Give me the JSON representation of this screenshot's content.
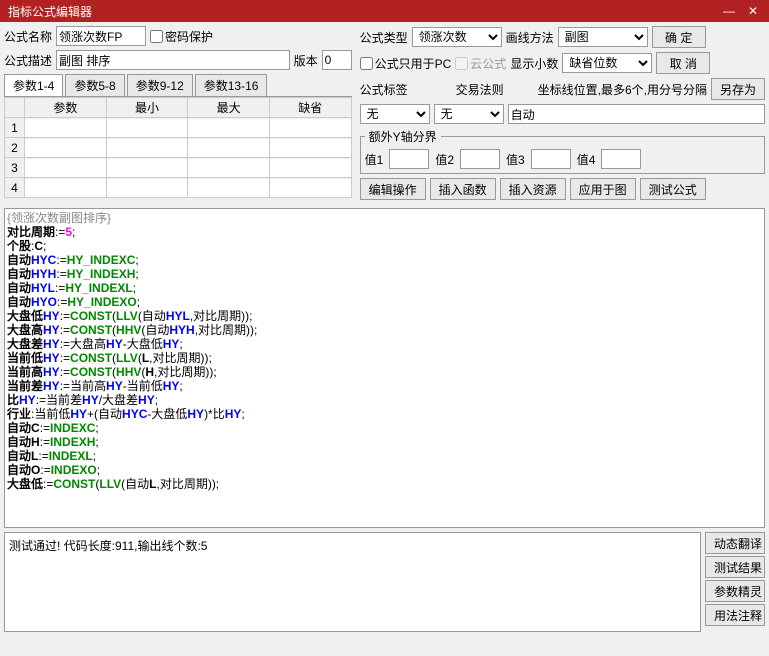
{
  "window": {
    "title": "指标公式编辑器"
  },
  "labels": {
    "formula_name": "公式名称",
    "password_protect": "密码保护",
    "formula_desc": "公式描述",
    "version": "版本",
    "formula_type": "公式类型",
    "draw_method": "画线方法",
    "pc_only": "公式只用于PC",
    "cloud_formula": "云公式",
    "show_decimal": "显示小数",
    "formula_tag": "公式标签",
    "trade_rule": "交易法则",
    "coord_lines": "坐标线位置,最多6个,用分号分隔",
    "extra_yaxis": "额外Y轴分界",
    "val1": "值1",
    "val2": "值2",
    "val3": "值3",
    "val4": "值4"
  },
  "form": {
    "name": "领涨次数FP",
    "desc": "副图 排序",
    "version": "0",
    "type_selected": "领涨次数",
    "draw_selected": "副图",
    "decimal_selected": "缺省位数",
    "tag_selected": "无",
    "rule_selected": "无",
    "coord_lines": "自动",
    "y1": "",
    "y2": "",
    "y3": "",
    "y4": ""
  },
  "tabs": {
    "t1": "参数1-4",
    "t2": "参数5-8",
    "t3": "参数9-12",
    "t4": "参数13-16"
  },
  "param_headers": {
    "h1": "参数",
    "h2": "最小",
    "h3": "最大",
    "h4": "缺省"
  },
  "param_rows": [
    "1",
    "2",
    "3",
    "4"
  ],
  "buttons": {
    "ok": "确 定",
    "cancel": "取 消",
    "save_as": "另存为",
    "edit_op": "编辑操作",
    "insert_func": "插入函数",
    "insert_res": "插入资源",
    "apply_chart": "应用于图",
    "test_formula": "测试公式",
    "dyn_trans": "动态翻译",
    "test_result": "测试结果",
    "param_wizard": "参数精灵",
    "usage_notes": "用法注释"
  },
  "code_lines": [
    {
      "segs": [
        {
          "t": "{领涨次数副图排序}",
          "c": "gray"
        }
      ]
    },
    {
      "segs": [
        {
          "t": "对比周期",
          "c": "kw-bold"
        },
        {
          "t": ":=",
          "c": ""
        },
        {
          "t": "5",
          "c": "kw-pink"
        },
        {
          "t": ";",
          "c": ""
        }
      ]
    },
    {
      "segs": [
        {
          "t": "个股",
          "c": "kw-bold"
        },
        {
          "t": ":",
          "c": ""
        },
        {
          "t": "C",
          "c": "kw-bold"
        },
        {
          "t": ";",
          "c": ""
        }
      ]
    },
    {
      "segs": [
        {
          "t": "自动",
          "c": "kw-bold"
        },
        {
          "t": "HYC",
          "c": "kw-blue"
        },
        {
          "t": ":=",
          "c": ""
        },
        {
          "t": "HY_INDEXC",
          "c": "kw-green"
        },
        {
          "t": ";",
          "c": ""
        }
      ]
    },
    {
      "segs": [
        {
          "t": "自动",
          "c": "kw-bold"
        },
        {
          "t": "HYH",
          "c": "kw-blue"
        },
        {
          "t": ":=",
          "c": ""
        },
        {
          "t": "HY_INDEXH",
          "c": "kw-green"
        },
        {
          "t": ";",
          "c": ""
        }
      ]
    },
    {
      "segs": [
        {
          "t": "自动",
          "c": "kw-bold"
        },
        {
          "t": "HYL",
          "c": "kw-blue"
        },
        {
          "t": ":=",
          "c": ""
        },
        {
          "t": "HY_INDEXL",
          "c": "kw-green"
        },
        {
          "t": ";",
          "c": ""
        }
      ]
    },
    {
      "segs": [
        {
          "t": "自动",
          "c": "kw-bold"
        },
        {
          "t": "HYO",
          "c": "kw-blue"
        },
        {
          "t": ":=",
          "c": ""
        },
        {
          "t": "HY_INDEXO",
          "c": "kw-green"
        },
        {
          "t": ";",
          "c": ""
        }
      ]
    },
    {
      "segs": [
        {
          "t": "大盘低",
          "c": "kw-bold"
        },
        {
          "t": "HY",
          "c": "kw-blue"
        },
        {
          "t": ":=",
          "c": ""
        },
        {
          "t": "CONST",
          "c": "kw-green"
        },
        {
          "t": "(",
          "c": ""
        },
        {
          "t": "LLV",
          "c": "kw-green"
        },
        {
          "t": "(自动",
          "c": ""
        },
        {
          "t": "HYL",
          "c": "kw-blue"
        },
        {
          "t": ",对比周期));",
          "c": ""
        }
      ]
    },
    {
      "segs": [
        {
          "t": "大盘高",
          "c": "kw-bold"
        },
        {
          "t": "HY",
          "c": "kw-blue"
        },
        {
          "t": ":=",
          "c": ""
        },
        {
          "t": "CONST",
          "c": "kw-green"
        },
        {
          "t": "(",
          "c": ""
        },
        {
          "t": "HHV",
          "c": "kw-green"
        },
        {
          "t": "(自动",
          "c": ""
        },
        {
          "t": "HYH",
          "c": "kw-blue"
        },
        {
          "t": ",对比周期));",
          "c": ""
        }
      ]
    },
    {
      "segs": [
        {
          "t": "大盘差",
          "c": "kw-bold"
        },
        {
          "t": "HY",
          "c": "kw-blue"
        },
        {
          "t": ":=大盘高",
          "c": ""
        },
        {
          "t": "HY",
          "c": "kw-blue"
        },
        {
          "t": "-大盘低",
          "c": ""
        },
        {
          "t": "HY",
          "c": "kw-blue"
        },
        {
          "t": ";",
          "c": ""
        }
      ]
    },
    {
      "segs": [
        {
          "t": "当前低",
          "c": "kw-bold"
        },
        {
          "t": "HY",
          "c": "kw-blue"
        },
        {
          "t": ":=",
          "c": ""
        },
        {
          "t": "CONST",
          "c": "kw-green"
        },
        {
          "t": "(",
          "c": ""
        },
        {
          "t": "LLV",
          "c": "kw-green"
        },
        {
          "t": "(",
          "c": ""
        },
        {
          "t": "L",
          "c": "kw-bold"
        },
        {
          "t": ",对比周期));",
          "c": ""
        }
      ]
    },
    {
      "segs": [
        {
          "t": "当前高",
          "c": "kw-bold"
        },
        {
          "t": "HY",
          "c": "kw-blue"
        },
        {
          "t": ":=",
          "c": ""
        },
        {
          "t": "CONST",
          "c": "kw-green"
        },
        {
          "t": "(",
          "c": ""
        },
        {
          "t": "HHV",
          "c": "kw-green"
        },
        {
          "t": "(",
          "c": ""
        },
        {
          "t": "H",
          "c": "kw-bold"
        },
        {
          "t": ",对比周期));",
          "c": ""
        }
      ]
    },
    {
      "segs": [
        {
          "t": "当前差",
          "c": "kw-bold"
        },
        {
          "t": "HY",
          "c": "kw-blue"
        },
        {
          "t": ":=当前高",
          "c": ""
        },
        {
          "t": "HY",
          "c": "kw-blue"
        },
        {
          "t": "-当前低",
          "c": ""
        },
        {
          "t": "HY",
          "c": "kw-blue"
        },
        {
          "t": ";",
          "c": ""
        }
      ]
    },
    {
      "segs": [
        {
          "t": "比",
          "c": "kw-bold"
        },
        {
          "t": "HY",
          "c": "kw-blue"
        },
        {
          "t": ":=当前差",
          "c": ""
        },
        {
          "t": "HY",
          "c": "kw-blue"
        },
        {
          "t": "/大盘差",
          "c": ""
        },
        {
          "t": "HY",
          "c": "kw-blue"
        },
        {
          "t": ";",
          "c": ""
        }
      ]
    },
    {
      "segs": [
        {
          "t": "行业",
          "c": "kw-bold"
        },
        {
          "t": ":当前低",
          "c": ""
        },
        {
          "t": "HY",
          "c": "kw-blue"
        },
        {
          "t": "+(自动",
          "c": ""
        },
        {
          "t": "HYC",
          "c": "kw-blue"
        },
        {
          "t": "-大盘低",
          "c": ""
        },
        {
          "t": "HY",
          "c": "kw-blue"
        },
        {
          "t": ")*比",
          "c": ""
        },
        {
          "t": "HY",
          "c": "kw-blue"
        },
        {
          "t": ";",
          "c": ""
        }
      ]
    },
    {
      "segs": [
        {
          "t": "自动",
          "c": "kw-bold"
        },
        {
          "t": "C",
          "c": "kw-bold"
        },
        {
          "t": ":=",
          "c": ""
        },
        {
          "t": "INDEXC",
          "c": "kw-green"
        },
        {
          "t": ";",
          "c": ""
        }
      ]
    },
    {
      "segs": [
        {
          "t": "自动",
          "c": "kw-bold"
        },
        {
          "t": "H",
          "c": "kw-bold"
        },
        {
          "t": ":=",
          "c": ""
        },
        {
          "t": "INDEXH",
          "c": "kw-green"
        },
        {
          "t": ";",
          "c": ""
        }
      ]
    },
    {
      "segs": [
        {
          "t": "自动",
          "c": "kw-bold"
        },
        {
          "t": "L",
          "c": "kw-bold"
        },
        {
          "t": ":=",
          "c": ""
        },
        {
          "t": "INDEXL",
          "c": "kw-green"
        },
        {
          "t": ";",
          "c": ""
        }
      ]
    },
    {
      "segs": [
        {
          "t": "自动",
          "c": "kw-bold"
        },
        {
          "t": "O",
          "c": "kw-bold"
        },
        {
          "t": ":=",
          "c": ""
        },
        {
          "t": "INDEXO",
          "c": "kw-green"
        },
        {
          "t": ";",
          "c": ""
        }
      ]
    },
    {
      "segs": [
        {
          "t": "大盘低",
          "c": "kw-bold"
        },
        {
          "t": ":=",
          "c": ""
        },
        {
          "t": "CONST",
          "c": "kw-green"
        },
        {
          "t": "(",
          "c": ""
        },
        {
          "t": "LLV",
          "c": "kw-green"
        },
        {
          "t": "(自动",
          "c": ""
        },
        {
          "t": "L",
          "c": "kw-bold"
        },
        {
          "t": ",对比周期));",
          "c": ""
        }
      ]
    }
  ],
  "status": "测试通过! 代码长度:911,输出线个数:5"
}
